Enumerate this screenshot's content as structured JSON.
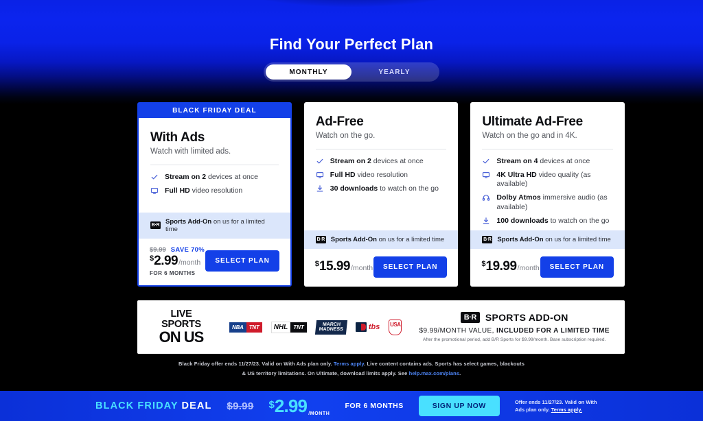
{
  "header": {
    "title": "Find Your Perfect Plan",
    "toggle": {
      "monthly": "MONTHLY",
      "yearly": "YEARLY",
      "selected": "MONTHLY"
    }
  },
  "theme": {
    "brand_blue": "#1340e8",
    "page_top_blue": "#0A22E6",
    "page_bottom_black": "#000000",
    "addon_strip_blue": "#dbe6fb",
    "cyan_accent": "#49e0ff"
  },
  "plans": [
    {
      "ribbon": "BLACK FRIDAY DEAL",
      "featured": true,
      "name": "With Ads",
      "tagline": "Watch with limited ads.",
      "features": [
        {
          "icon": "check-icon",
          "bold": "Stream on 2",
          "rest": " devices at once"
        },
        {
          "icon": "monitor-icon",
          "bold": "Full HD",
          "rest": " video resolution"
        }
      ],
      "addon_note": {
        "bold": "Sports Add-On",
        "rest": " on us for a limited time",
        "icon": "br-sports-icon"
      },
      "pricing": {
        "strikethrough": "$9.99",
        "save_label": "SAVE 70%",
        "currency": "$",
        "amount": "2.99",
        "period": "/month",
        "term": "FOR 6 MONTHS"
      },
      "cta": "SELECT PLAN"
    },
    {
      "ribbon": "",
      "featured": false,
      "name": "Ad-Free",
      "tagline": "Watch on the go.",
      "features": [
        {
          "icon": "check-icon",
          "bold": "Stream on 2",
          "rest": " devices at once"
        },
        {
          "icon": "monitor-icon",
          "bold": "Full HD",
          "rest": " video resolution"
        },
        {
          "icon": "download-icon",
          "bold": "30 downloads",
          "rest": " to watch on the go"
        }
      ],
      "addon_note": {
        "bold": "Sports Add-On",
        "rest": " on us for a limited time",
        "icon": "br-sports-icon"
      },
      "pricing": {
        "strikethrough": "",
        "save_label": "",
        "currency": "$",
        "amount": "15.99",
        "period": "/month",
        "term": ""
      },
      "cta": "SELECT PLAN"
    },
    {
      "ribbon": "",
      "featured": false,
      "name": "Ultimate Ad-Free",
      "tagline": "Watch on the go and in 4K.",
      "features": [
        {
          "icon": "check-icon",
          "bold": "Stream on 4",
          "rest": " devices at once"
        },
        {
          "icon": "monitor-icon",
          "bold": "4K Ultra HD",
          "rest": " video quality (as available)"
        },
        {
          "icon": "headphones-icon",
          "bold": "Dolby Atmos",
          "rest": " immersive audio (as available)"
        },
        {
          "icon": "download-icon",
          "bold": "100 downloads",
          "rest": " to watch on the go"
        }
      ],
      "addon_note": {
        "bold": "Sports Add-On",
        "rest": " on us for a limited time",
        "icon": "br-sports-icon"
      },
      "pricing": {
        "strikethrough": "",
        "save_label": "",
        "currency": "$",
        "amount": "19.99",
        "period": "/month",
        "term": ""
      },
      "cta": "SELECT PLAN"
    }
  ],
  "sports_banner": {
    "live_line1": "LIVE SPORTS",
    "live_line2": "ON US",
    "logos": [
      {
        "name": "nba-tnt-logo",
        "a": "NBA",
        "b": "TNT"
      },
      {
        "name": "nhl-tnt-logo",
        "a": "NHL",
        "b": "TNT"
      },
      {
        "name": "march-madness-logo",
        "a": "MARCH",
        "b": "MADNESS"
      },
      {
        "name": "mlb-tbs-logo",
        "a": "",
        "b": "tbs"
      },
      {
        "name": "usa-soccer-logo",
        "a": "USA",
        "b": ""
      }
    ],
    "br_badge": "B·R",
    "addon_title": "SPORTS ADD-ON",
    "addon_value_lead": "$9.99/MONTH VALUE, ",
    "addon_value_bold": "INCLUDED FOR A LIMITED TIME",
    "addon_fine": "After the promotional period, add B/R Sports for $9.99/month. Base subscription required."
  },
  "disclaimer": {
    "part1": "Black Friday offer ends 11/27/23. Valid on With Ads plan only.",
    "link1": "Terms apply",
    "part2": ". Live content contains ads. Sports has select games, blackouts & US territory limitations. On Ultimate, download limits apply. See",
    "link2": "help.max.com/plans",
    "part3": "."
  },
  "bottom_bar": {
    "deal_prefix": "BLACK FRIDAY",
    "deal_suffix": "DEAL",
    "strikethrough": "$9.99",
    "currency": "$",
    "amount": "2.99",
    "per": "/MONTH",
    "term": "FOR 6 MONTHS",
    "cta": "SIGN UP NOW",
    "fine_part1": "Offer ends 11/27/23. Valid on With Ads plan only.",
    "fine_link": "Terms apply."
  }
}
